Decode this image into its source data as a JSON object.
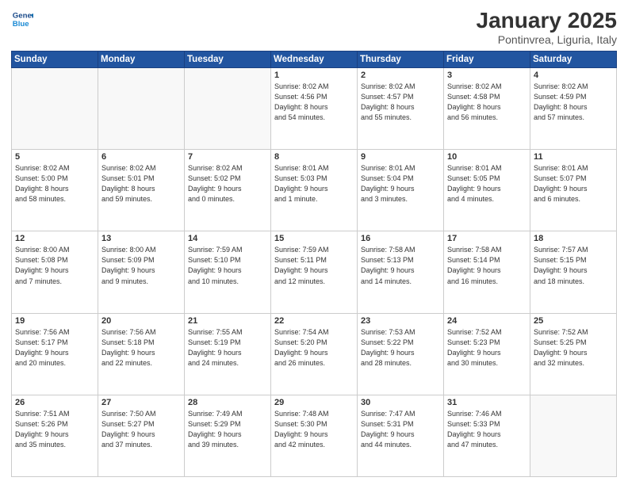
{
  "header": {
    "logo_line1": "General",
    "logo_line2": "Blue",
    "month": "January 2025",
    "location": "Pontinvrea, Liguria, Italy"
  },
  "days_of_week": [
    "Sunday",
    "Monday",
    "Tuesday",
    "Wednesday",
    "Thursday",
    "Friday",
    "Saturday"
  ],
  "weeks": [
    [
      {
        "day": "",
        "info": ""
      },
      {
        "day": "",
        "info": ""
      },
      {
        "day": "",
        "info": ""
      },
      {
        "day": "1",
        "info": "Sunrise: 8:02 AM\nSunset: 4:56 PM\nDaylight: 8 hours\nand 54 minutes."
      },
      {
        "day": "2",
        "info": "Sunrise: 8:02 AM\nSunset: 4:57 PM\nDaylight: 8 hours\nand 55 minutes."
      },
      {
        "day": "3",
        "info": "Sunrise: 8:02 AM\nSunset: 4:58 PM\nDaylight: 8 hours\nand 56 minutes."
      },
      {
        "day": "4",
        "info": "Sunrise: 8:02 AM\nSunset: 4:59 PM\nDaylight: 8 hours\nand 57 minutes."
      }
    ],
    [
      {
        "day": "5",
        "info": "Sunrise: 8:02 AM\nSunset: 5:00 PM\nDaylight: 8 hours\nand 58 minutes."
      },
      {
        "day": "6",
        "info": "Sunrise: 8:02 AM\nSunset: 5:01 PM\nDaylight: 8 hours\nand 59 minutes."
      },
      {
        "day": "7",
        "info": "Sunrise: 8:02 AM\nSunset: 5:02 PM\nDaylight: 9 hours\nand 0 minutes."
      },
      {
        "day": "8",
        "info": "Sunrise: 8:01 AM\nSunset: 5:03 PM\nDaylight: 9 hours\nand 1 minute."
      },
      {
        "day": "9",
        "info": "Sunrise: 8:01 AM\nSunset: 5:04 PM\nDaylight: 9 hours\nand 3 minutes."
      },
      {
        "day": "10",
        "info": "Sunrise: 8:01 AM\nSunset: 5:05 PM\nDaylight: 9 hours\nand 4 minutes."
      },
      {
        "day": "11",
        "info": "Sunrise: 8:01 AM\nSunset: 5:07 PM\nDaylight: 9 hours\nand 6 minutes."
      }
    ],
    [
      {
        "day": "12",
        "info": "Sunrise: 8:00 AM\nSunset: 5:08 PM\nDaylight: 9 hours\nand 7 minutes."
      },
      {
        "day": "13",
        "info": "Sunrise: 8:00 AM\nSunset: 5:09 PM\nDaylight: 9 hours\nand 9 minutes."
      },
      {
        "day": "14",
        "info": "Sunrise: 7:59 AM\nSunset: 5:10 PM\nDaylight: 9 hours\nand 10 minutes."
      },
      {
        "day": "15",
        "info": "Sunrise: 7:59 AM\nSunset: 5:11 PM\nDaylight: 9 hours\nand 12 minutes."
      },
      {
        "day": "16",
        "info": "Sunrise: 7:58 AM\nSunset: 5:13 PM\nDaylight: 9 hours\nand 14 minutes."
      },
      {
        "day": "17",
        "info": "Sunrise: 7:58 AM\nSunset: 5:14 PM\nDaylight: 9 hours\nand 16 minutes."
      },
      {
        "day": "18",
        "info": "Sunrise: 7:57 AM\nSunset: 5:15 PM\nDaylight: 9 hours\nand 18 minutes."
      }
    ],
    [
      {
        "day": "19",
        "info": "Sunrise: 7:56 AM\nSunset: 5:17 PM\nDaylight: 9 hours\nand 20 minutes."
      },
      {
        "day": "20",
        "info": "Sunrise: 7:56 AM\nSunset: 5:18 PM\nDaylight: 9 hours\nand 22 minutes."
      },
      {
        "day": "21",
        "info": "Sunrise: 7:55 AM\nSunset: 5:19 PM\nDaylight: 9 hours\nand 24 minutes."
      },
      {
        "day": "22",
        "info": "Sunrise: 7:54 AM\nSunset: 5:20 PM\nDaylight: 9 hours\nand 26 minutes."
      },
      {
        "day": "23",
        "info": "Sunrise: 7:53 AM\nSunset: 5:22 PM\nDaylight: 9 hours\nand 28 minutes."
      },
      {
        "day": "24",
        "info": "Sunrise: 7:52 AM\nSunset: 5:23 PM\nDaylight: 9 hours\nand 30 minutes."
      },
      {
        "day": "25",
        "info": "Sunrise: 7:52 AM\nSunset: 5:25 PM\nDaylight: 9 hours\nand 32 minutes."
      }
    ],
    [
      {
        "day": "26",
        "info": "Sunrise: 7:51 AM\nSunset: 5:26 PM\nDaylight: 9 hours\nand 35 minutes."
      },
      {
        "day": "27",
        "info": "Sunrise: 7:50 AM\nSunset: 5:27 PM\nDaylight: 9 hours\nand 37 minutes."
      },
      {
        "day": "28",
        "info": "Sunrise: 7:49 AM\nSunset: 5:29 PM\nDaylight: 9 hours\nand 39 minutes."
      },
      {
        "day": "29",
        "info": "Sunrise: 7:48 AM\nSunset: 5:30 PM\nDaylight: 9 hours\nand 42 minutes."
      },
      {
        "day": "30",
        "info": "Sunrise: 7:47 AM\nSunset: 5:31 PM\nDaylight: 9 hours\nand 44 minutes."
      },
      {
        "day": "31",
        "info": "Sunrise: 7:46 AM\nSunset: 5:33 PM\nDaylight: 9 hours\nand 47 minutes."
      },
      {
        "day": "",
        "info": ""
      }
    ]
  ]
}
